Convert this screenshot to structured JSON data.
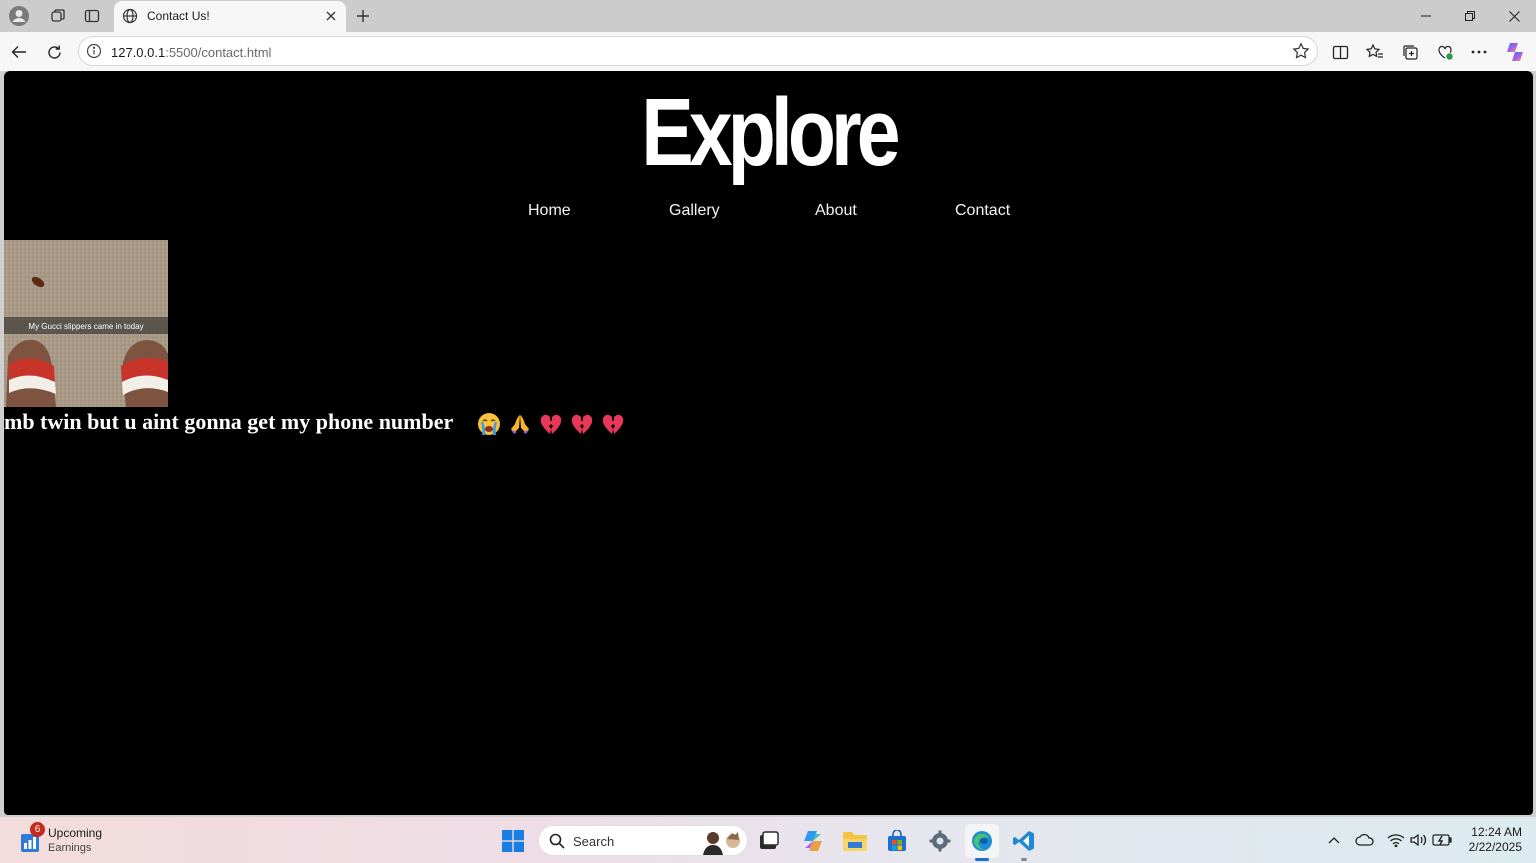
{
  "browser": {
    "tab_title": "Contact Us!",
    "address_host": "127.0.0.1",
    "address_path": ":5500/contact.html"
  },
  "page": {
    "logo": "Explore",
    "nav": [
      "Home",
      "Gallery",
      "About",
      "Contact"
    ],
    "photo_caption": "My Gucci slippers came in today",
    "message": "mb twin but u aint gonna get my phone number",
    "emojis": [
      "loudly-crying-face",
      "folded-hands",
      "broken-heart",
      "broken-heart",
      "broken-heart"
    ]
  },
  "taskbar": {
    "weather_badge": "6",
    "weather_title": "Upcoming",
    "weather_subtitle": "Earnings",
    "search_placeholder": "Search",
    "time": "12:24 AM",
    "date": "2/22/2025"
  },
  "colors": {
    "page_bg": "#000000",
    "text": "#ffffff",
    "broken_heart": "#e8385a"
  }
}
